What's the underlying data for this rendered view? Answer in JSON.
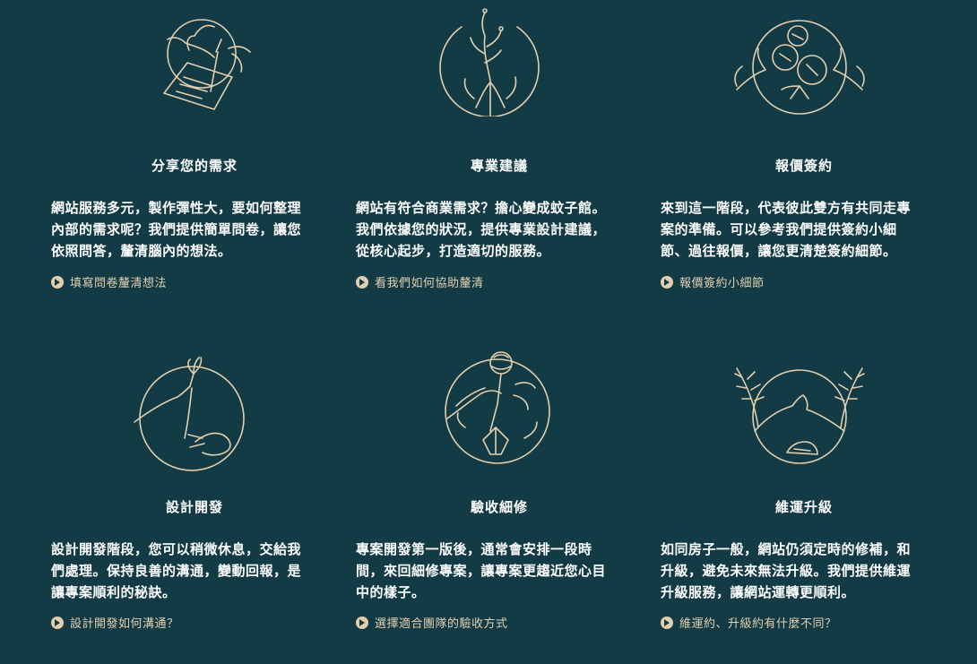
{
  "theme": {
    "background": "#123b45",
    "accent": "#e3cfae",
    "text": "#ffffff"
  },
  "cards": [
    {
      "icon": "hand-writing-icon",
      "title": "分享您的需求",
      "desc": [
        "網站服務多元，製作彈性大，要如何整理",
        "內部的需求呢？我們提供簡單問卷，讓您",
        "依照問答，釐清腦內的想法。"
      ],
      "link": "填寫問卷釐清想法"
    },
    {
      "icon": "hand-sprout-icon",
      "title": "專業建議",
      "desc": [
        "網站有符合商業需求？擔心變成蚊子館。",
        "我們依據您的狀況，提供專業設計建議，",
        "從核心起步，打造適切的服務。"
      ],
      "link": "看我們如何協助釐清"
    },
    {
      "icon": "hands-flowers-icon",
      "title": "報價簽約",
      "desc": [
        "來到這一階段，代表彼此雙方有共同走專",
        "案的準備。可以參考我們提供簽約小細",
        "節、過往報價，讓您更清楚簽約細節。"
      ],
      "link": "報價簽約小細節"
    },
    {
      "icon": "hands-passing-flower-icon",
      "title": "設計開發",
      "desc": [
        "設計開發階段，您可以稍微休息，交給我",
        "們處理。保持良善的溝通，變動回報，是",
        "讓專案順利的秘訣。"
      ],
      "link": "設計開發如何溝通？"
    },
    {
      "icon": "hand-holding-bouquet-icon",
      "title": "驗收細修",
      "desc": [
        "專案開發第一版後，通常會安排一段時",
        "間，來回細修專案，讓專案更趨近您心目",
        "中的樣子。"
      ],
      "link": "選擇適合團隊的驗收方式"
    },
    {
      "icon": "pinky-promise-icon",
      "title": "維運升級",
      "desc": [
        "如同房子一般，網站仍須定時的修補，和",
        "升級，避免未來無法升級。我們提供維運",
        "升級服務，讓網站運轉更順利。"
      ],
      "link": "維運約、升級約有什麼不同？"
    }
  ]
}
